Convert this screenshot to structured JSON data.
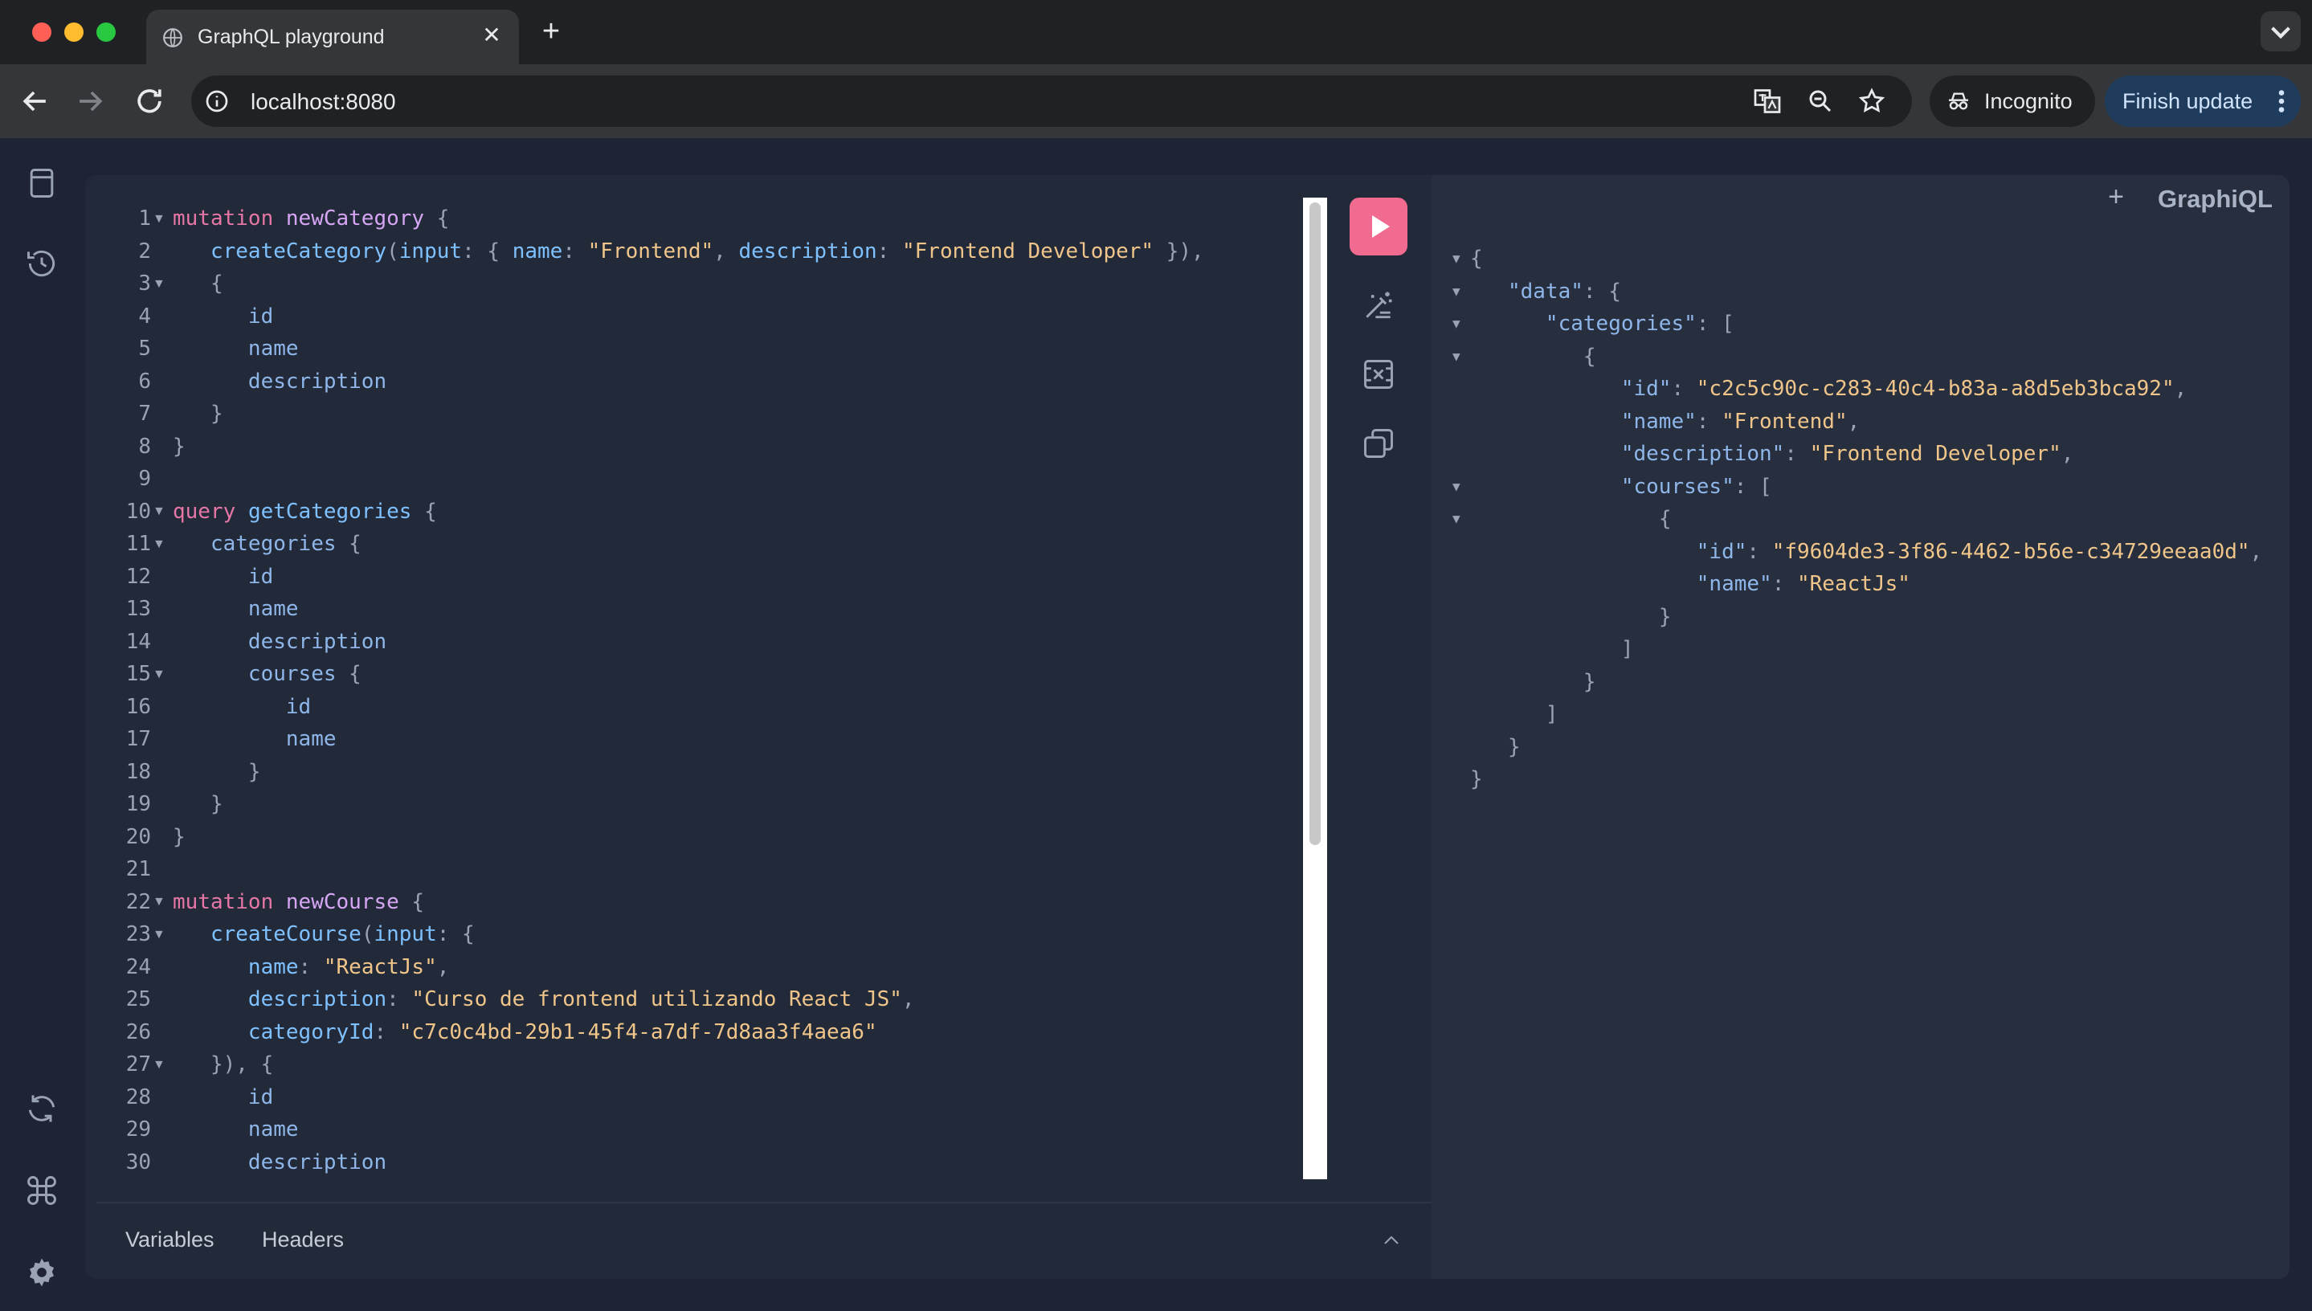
{
  "browser": {
    "tab_title": "GraphQL playground",
    "url": "localhost:8080",
    "incognito_label": "Incognito",
    "finish_update_label": "Finish update"
  },
  "editor": {
    "line_numbers": [
      "1",
      "2",
      "3",
      "4",
      "5",
      "6",
      "7",
      "8",
      "9",
      "10",
      "11",
      "12",
      "13",
      "14",
      "15",
      "16",
      "17",
      "18",
      "19",
      "20",
      "21",
      "22",
      "23",
      "24",
      "25",
      "26",
      "27",
      "28",
      "29",
      "30"
    ],
    "code": {
      "l1_kw": "mutation",
      "l1_name": "newCategory",
      "l1_brace": " {",
      "l2_fn": "createCategory",
      "l2_p1": "(",
      "l2_arg": "input",
      "l2_p2": ": { ",
      "l2_k1": "name",
      "l2_p3": ": ",
      "l2_v1": "\"Frontend\"",
      "l2_p4": ", ",
      "l2_k2": "description",
      "l2_p5": ": ",
      "l2_v2": "\"Frontend Developer\"",
      "l2_p6": " }),",
      "l3": "{",
      "l4": "id",
      "l5": "name",
      "l6": "description",
      "l7": "}",
      "l8": "}",
      "l10_kw": "query",
      "l10_name": "getCategories",
      "l10_brace": " {",
      "l11_fn": "categories",
      "l11_brace": " {",
      "l12": "id",
      "l13": "name",
      "l14": "description",
      "l15_fn": "courses",
      "l15_brace": " {",
      "l16": "id",
      "l17": "name",
      "l18": "}",
      "l19": "}",
      "l20": "}",
      "l22_kw": "mutation",
      "l22_name": "newCourse",
      "l22_brace": " {",
      "l23_fn": "createCourse",
      "l23_p1": "(",
      "l23_arg": "input",
      "l23_p2": ": {",
      "l24_k": "name",
      "l24_p": ": ",
      "l24_v": "\"ReactJs\"",
      "l24_c": ",",
      "l25_k": "description",
      "l25_p": ": ",
      "l25_v": "\"Curso de frontend utilizando React JS\"",
      "l25_c": ",",
      "l26_k": "categoryId",
      "l26_p": ": ",
      "l26_v": "\"c7c0c4bd-29b1-45f4-a7df-7d8aa3f4aea6\"",
      "l27": "}), {",
      "l28": "id",
      "l29": "name",
      "l30": "description"
    },
    "tabs": {
      "variables": "Variables",
      "headers": "Headers"
    }
  },
  "results": {
    "brand": "GraphiQL",
    "add_tab": "+",
    "json": {
      "open": "{",
      "data_key": "\"data\"",
      "colon": ": ",
      "obj_open": "{",
      "categories_key": "\"categories\"",
      "arr_open": "[",
      "id_key": "\"id\"",
      "id_val": "\"c2c5c90c-c283-40c4-b83a-a8d5eb3bca92\"",
      "name_key": "\"name\"",
      "name_val": "\"Frontend\"",
      "desc_key": "\"description\"",
      "desc_val": "\"Frontend Developer\"",
      "courses_key": "\"courses\"",
      "course_id_val": "\"f9604de3-3f86-4462-b56e-c34729eeaa0d\"",
      "course_name_val": "\"ReactJs\"",
      "comma": ",",
      "close_obj": "}",
      "close_arr": "]"
    }
  },
  "icons": {
    "sidebar_top": [
      "docs-icon",
      "history-icon"
    ],
    "sidebar_bottom": [
      "refetch-schema-icon",
      "shortcuts-icon",
      "settings-icon"
    ],
    "toolbar": [
      "run-icon",
      "prettify-icon",
      "merge-fragments-icon",
      "copy-icon"
    ]
  },
  "colors": {
    "run_button": "#f16a8f",
    "background": "#1e2433",
    "editor": "#222a3a",
    "string": "#f0c58a",
    "keyword": "#e576a5"
  }
}
